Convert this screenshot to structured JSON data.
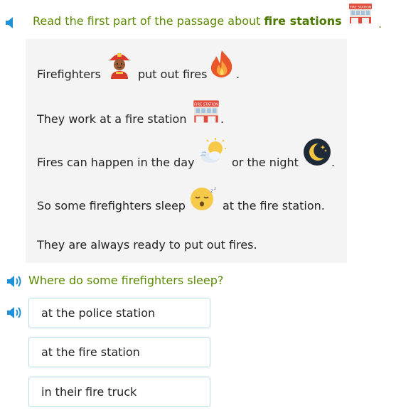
{
  "instruction": {
    "text_before": "Read the first part of the passage about",
    "text_bold": "fire stations",
    "period": "."
  },
  "passage": {
    "lines": [
      {
        "text": "Firefighters",
        "after": "put out fires",
        "end": "."
      },
      {
        "text": "They work at a fire station",
        "end": "."
      },
      {
        "text": "Fires can happen in the day",
        "after": "or the night",
        "end": "."
      },
      {
        "text": "So some firefighters sleep",
        "after": "at the fire station."
      },
      {
        "text": "They are always ready to put out fires."
      }
    ],
    "sign_text": "FIRE STATION"
  },
  "question": {
    "text": "Where do some firefighters sleep?"
  },
  "choices": [
    {
      "label": "at the police station"
    },
    {
      "label": "at the fire station"
    },
    {
      "label": "in their fire truck"
    }
  ],
  "colors": {
    "accent_green": "#5a8a00",
    "speaker_blue": "#1e90d6",
    "choice_border": "#b5dcea",
    "passage_bg": "#f4f4f4"
  },
  "icons": [
    "speaker-icon",
    "fire-station-icon",
    "firefighter-icon",
    "fire-icon",
    "sun-cloud-icon",
    "moon-icon",
    "sleeping-face-icon"
  ]
}
